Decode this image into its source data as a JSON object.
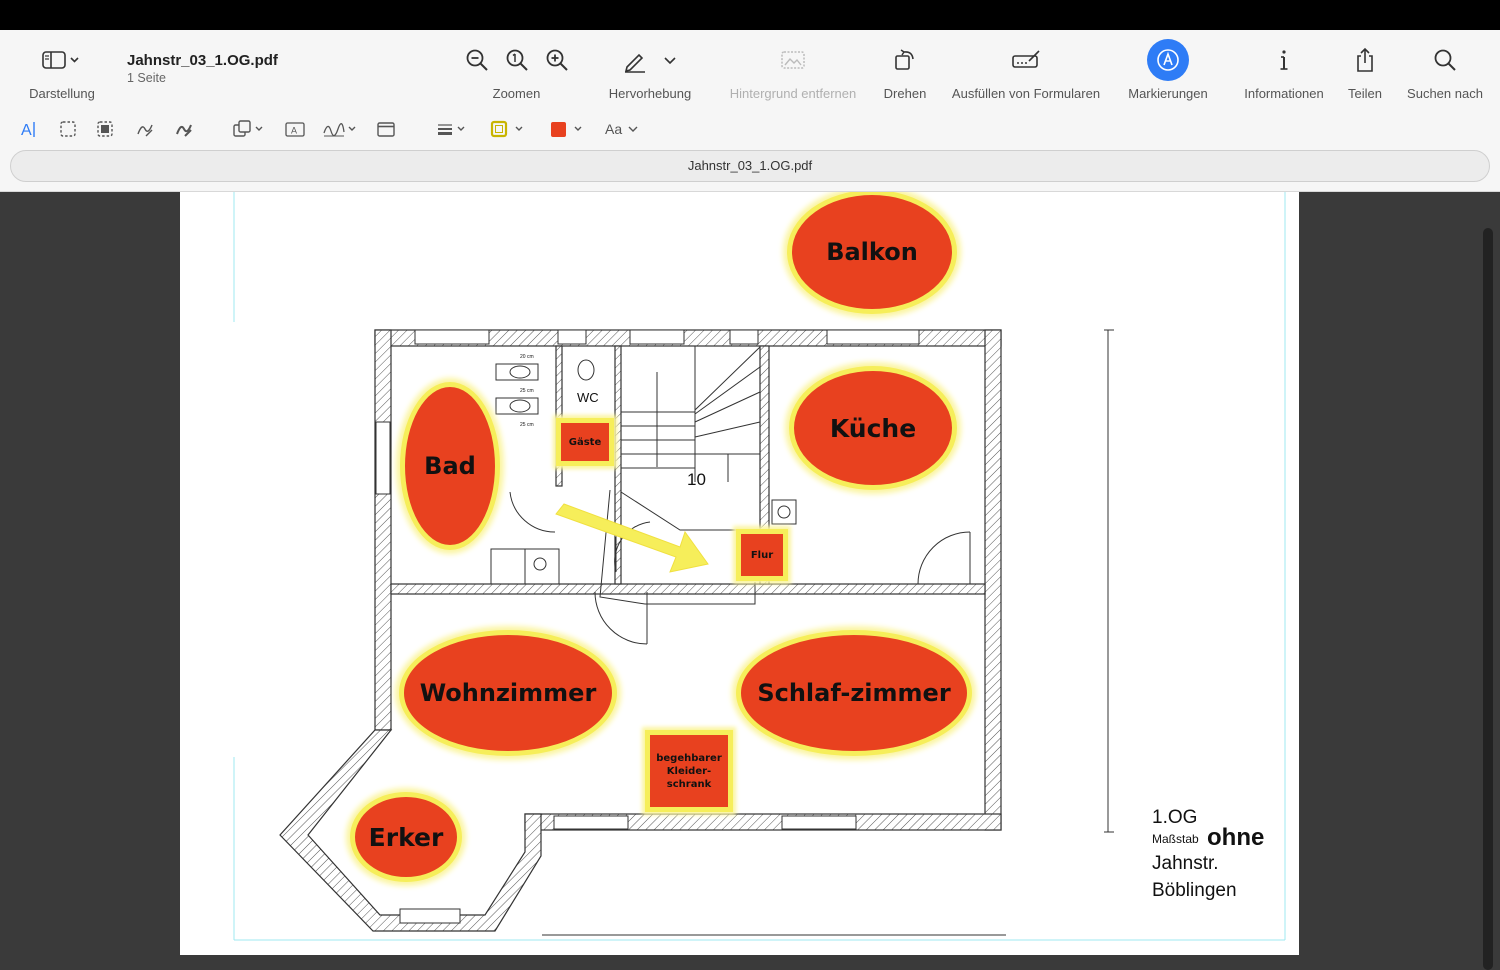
{
  "window": {
    "doc_title": "Jahnstr_03_1.OG.pdf",
    "doc_pages": "1 Seite",
    "tab_title": "Jahnstr_03_1.OG.pdf"
  },
  "toolbar": {
    "sidebar_label": "Darstellung",
    "zoom_label": "Zoomen",
    "highlight_label": "Hervorhebung",
    "remove_bg_label": "Hintergrund entfernen",
    "rotate_label": "Drehen",
    "forms_label": "Ausfüllen von Formularen",
    "markup_label": "Markierungen",
    "info_label": "Informationen",
    "share_label": "Teilen",
    "search_label": "Suchen nach",
    "font_label": "Aa"
  },
  "colors": {
    "room_fill": "#e8411f",
    "room_border": "#f6ee5a",
    "accent": "#2e7cf6"
  },
  "floorplan": {
    "rooms": {
      "balkon": "Balkon",
      "kueche": "Küche",
      "bad": "Bad",
      "wohnzimmer": "Wohnzimmer",
      "schlafzimmer": "Schlaf-zimmer",
      "erker": "Erker",
      "gaeste": "Gäste",
      "flur": "Flur",
      "kleiderschrank": "begehbarer Kleider-schrank"
    },
    "wc_label": "WC",
    "stair_count": "10",
    "tiny_labels": [
      "20 cm",
      "25 cm",
      "25 cm"
    ],
    "legend": {
      "floor": "1.OG",
      "scale_prefix": "Maßstab",
      "scale_value": "ohne",
      "street": "Jahnstr.",
      "city": "Böblingen"
    }
  }
}
